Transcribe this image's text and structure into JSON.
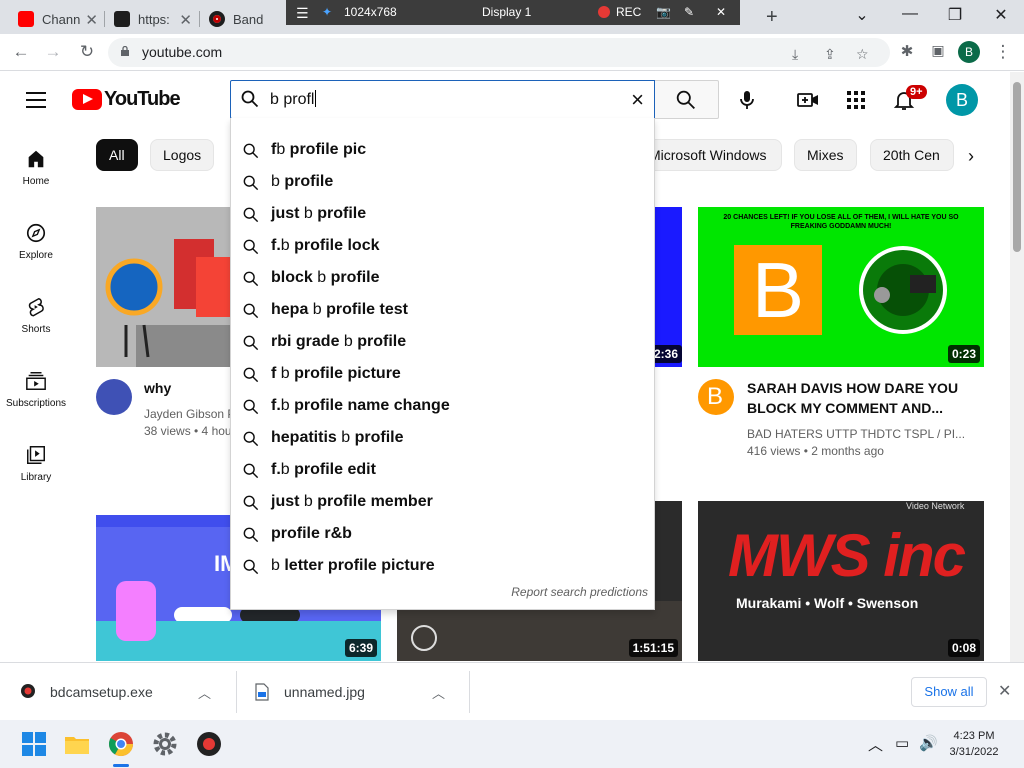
{
  "browser": {
    "tabs": [
      {
        "title": "Chann",
        "color": "#ff0000"
      },
      {
        "title": "https:",
        "color": "#1e1e1e"
      },
      {
        "title": "Band",
        "color": "#c00000"
      }
    ],
    "url": "youtube.com",
    "profile_initial": "B"
  },
  "recorder": {
    "resolution": "1024x768",
    "display": "Display 1",
    "rec_label": "REC"
  },
  "youtube": {
    "logo_text": "YouTube",
    "search_query": "b profl",
    "notification_count": "9+",
    "avatar_initial": "B",
    "guide": [
      {
        "label": "Home",
        "icon": "home-icon"
      },
      {
        "label": "Explore",
        "icon": "explore-icon"
      },
      {
        "label": "Shorts",
        "icon": "shorts-icon"
      },
      {
        "label": "Subscriptions",
        "icon": "subscriptions-icon"
      },
      {
        "label": "Library",
        "icon": "library-icon"
      }
    ],
    "chips": [
      "All",
      "Logos",
      "Microsoft Windows",
      "Mixes",
      "20th Cen"
    ],
    "suggestions": [
      {
        "pre": "f",
        "q": "b",
        "post": " profile pic"
      },
      {
        "pre": "",
        "q": "b",
        "post": " profile"
      },
      {
        "pre": "just ",
        "q": "b",
        "post": " profile"
      },
      {
        "pre": "f.",
        "q": "b",
        "post": " profile lock"
      },
      {
        "pre": "block ",
        "q": "b",
        "post": " profile"
      },
      {
        "pre": "hepa ",
        "q": "b",
        "post": " profile test"
      },
      {
        "pre": "rbi grade ",
        "q": "b",
        "post": " profile"
      },
      {
        "pre": "f ",
        "q": "b",
        "post": " profile picture"
      },
      {
        "pre": "f.",
        "q": "b",
        "post": " profile name change"
      },
      {
        "pre": "hepatitis ",
        "q": "b",
        "post": " profile"
      },
      {
        "pre": "f.",
        "q": "b",
        "post": " profile edit"
      },
      {
        "pre": "just ",
        "q": "b",
        "post": " profile member"
      },
      {
        "pre": "",
        "q": "",
        "post": "profile r&b"
      },
      {
        "pre": "",
        "q": "b",
        "post": " letter profile picture"
      }
    ],
    "report_link": "Report search predictions",
    "videos": [
      {
        "title": "why school!!!!",
        "channel": "Jayden Gibson P",
        "meta": "38 views • 4 hou",
        "duration": ""
      },
      {
        "title": "",
        "channel": "",
        "meta": "",
        "duration": "2:36"
      },
      {
        "title": "SARAH DAVIS HOW DARE YOU BLOCK MY COMMENT AND...",
        "channel": "BAD HATERS UTTP THDTC TSPL / PI...",
        "meta": "416 views • 2 months ago",
        "duration": "0:23"
      },
      {
        "title": "",
        "channel": "",
        "meta": "",
        "duration": "6:39"
      },
      {
        "title": "",
        "channel": "",
        "meta": "",
        "duration": "1:51:15"
      },
      {
        "title": "",
        "channel": "",
        "meta": "",
        "duration": "0:08"
      }
    ],
    "thumb_texts": {
      "green_top": "20 CHANCES LEFT! IF YOU LOSE ALL OF THEM, I WILL HATE YOU SO FREAKING GODDAMN MUCH!",
      "green_letter": "B",
      "discord_word": "IMAGINE",
      "mws_logo": "MWS inc",
      "mws_sub": "Murakami • Wolf • Swenson",
      "mws_network": "Video Network"
    }
  },
  "downloads": {
    "items": [
      {
        "name": "bdcamsetup.exe"
      },
      {
        "name": "unnamed.jpg"
      }
    ],
    "show_all": "Show all"
  },
  "taskbar": {
    "time": "4:23 PM",
    "date": "3/31/2022"
  },
  "colors": {
    "youtube_red": "#ff0000",
    "search_focus": "#1c62b9",
    "avatar": "#0097a7",
    "link_blue": "#1a73e8"
  }
}
